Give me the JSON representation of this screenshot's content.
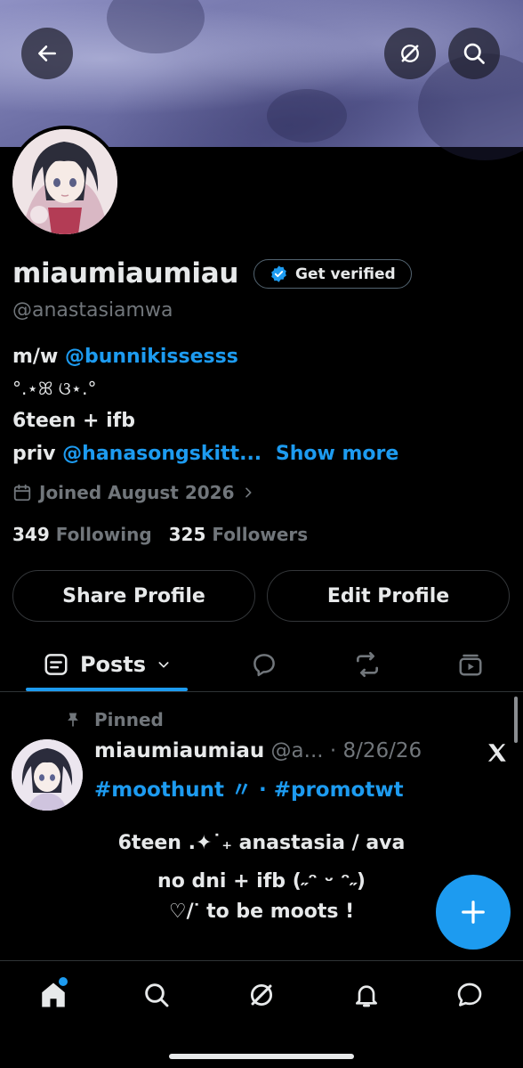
{
  "profile": {
    "display_name": "miaumiaumiau",
    "handle": "@anastasiamwa",
    "get_verified_label": "Get verified",
    "bio": {
      "line1_prefix": "m/w",
      "line1_mention": "@bunnikissesss",
      "line2": "°.⋆ꕤ ଓ⋆.°",
      "line3": "6teen + ifb",
      "line4_prefix": "priv",
      "line4_mention": "@hanasongskitt...",
      "show_more": "Show more"
    },
    "joined": "Joined August 2026",
    "following_count": "349",
    "following_label": "Following",
    "followers_count": "325",
    "followers_label": "Followers"
  },
  "actions": {
    "share_profile": "Share Profile",
    "edit_profile": "Edit Profile"
  },
  "tabs": {
    "posts_label": "Posts"
  },
  "pinned_post": {
    "pinned_label": "Pinned",
    "author_name": "miaumiaumiau",
    "author_handle": "@a...",
    "separator": "·",
    "date": "8/26/26",
    "hashtags": "#moothunt 〃 · #promotwt",
    "body_line1": "6teen .✦˙₊ anastasia / ava",
    "body_line2": "no dni + ifb (˶ᵔ ᵕ ᵔ˶)",
    "body_line3": "♡/ᐝ to be moots !"
  },
  "icons": {
    "back": "arrow-left-icon",
    "grok": "grok-icon",
    "search": "search-icon",
    "verified": "verified-badge-icon",
    "calendar": "calendar-icon",
    "chevron": "chevron-right-icon",
    "posts": "posts-tab-icon",
    "replies": "replies-tab-icon",
    "reposts": "repost-tab-icon",
    "media": "media-tab-icon",
    "pin": "pin-icon",
    "x_logo": "x-logo-icon",
    "compose": "plus-icon",
    "nav_home": "home-icon",
    "nav_search": "search-icon",
    "nav_grok": "grok-icon",
    "nav_notifications": "bell-icon",
    "nav_messages": "chat-icon"
  },
  "colors": {
    "accent": "#1d9bf0",
    "muted": "#71767b",
    "text": "#e7e9ea",
    "background": "#000000"
  }
}
